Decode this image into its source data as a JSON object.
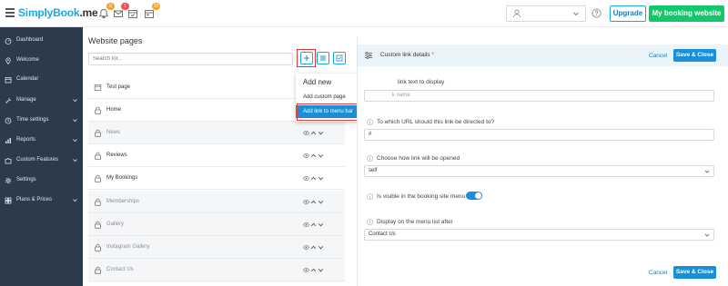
{
  "topbar": {
    "logo_main": "SimplyBook",
    "logo_suffix": ".me",
    "badges": {
      "notifications": "0",
      "messages": "1",
      "calendar": "10"
    },
    "upgrade_label": "Upgrade",
    "booking_label": "My booking website"
  },
  "sidebar": {
    "items": [
      {
        "label": "Dashboard",
        "icon": "dashboard-icon"
      },
      {
        "label": "Welcome",
        "icon": "pin-icon"
      },
      {
        "label": "Calendar",
        "icon": "calendar-icon"
      },
      {
        "label": "Manage",
        "icon": "wrench-icon"
      },
      {
        "label": "Time settings",
        "icon": "clock-icon"
      },
      {
        "label": "Reports",
        "icon": "chart-icon"
      },
      {
        "label": "Custom Features",
        "icon": "puzzle-icon"
      },
      {
        "label": "Settings",
        "icon": "gear-icon"
      },
      {
        "label": "Plans & Prices",
        "icon": "plans-icon"
      }
    ]
  },
  "pages": {
    "title": "Website pages",
    "search_placeholder": "Search for...",
    "rows": [
      {
        "label": "Test page",
        "icon": "page-icon",
        "alt": false
      },
      {
        "label": "Home",
        "icon": "lock-icon",
        "alt": false
      },
      {
        "label": "News",
        "icon": "lock-icon",
        "alt": true
      },
      {
        "label": "Reviews",
        "icon": "lock-icon",
        "alt": false
      },
      {
        "label": "My Bookings",
        "icon": "lock-icon",
        "alt": false
      },
      {
        "label": "Memberships",
        "icon": "lock-icon",
        "alt": true
      },
      {
        "label": "Gallery",
        "icon": "lock-icon",
        "alt": true
      },
      {
        "label": "Instagram Gallery",
        "icon": "lock-icon",
        "alt": true
      },
      {
        "label": "Contact Us",
        "icon": "lock-icon",
        "alt": true
      }
    ]
  },
  "dropdown": {
    "header": "Add new",
    "items": [
      "Add custom page",
      "Add link to menu bar"
    ]
  },
  "details": {
    "title": "Custom link details",
    "required_mark": "*",
    "cancel_label": "Cancel",
    "save_label": "Save & Close",
    "link_text_label": "link text to display",
    "link_text_placeholder": "k name",
    "url_label": "To which URL should this link be directed to?",
    "url_value": "#",
    "open_label": "Choose how link will be opened",
    "open_value": "self",
    "visible_label": "Is visible in the booking site menu",
    "after_label": "Display on the menu list after",
    "after_value": "Contact Us"
  },
  "colors": {
    "sidebar_bg": "#2c3b4c",
    "accent_blue": "#1a8fd8",
    "booking_green": "#11c86c",
    "highlight_red": "#e53935"
  }
}
